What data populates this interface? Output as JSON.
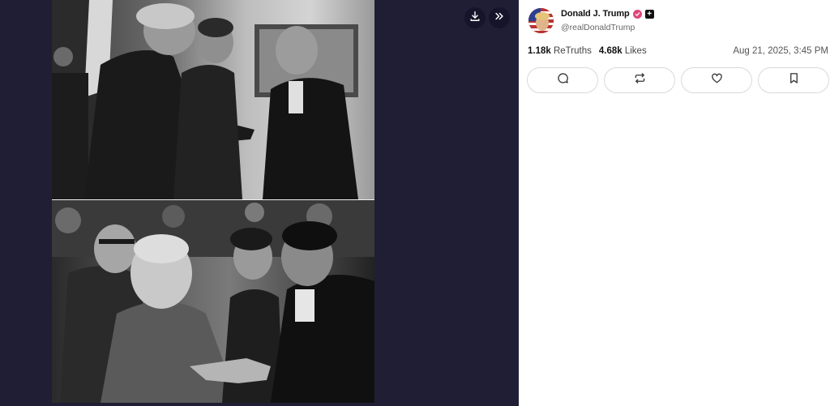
{
  "viewer": {
    "download_icon": "download-icon",
    "collapse_icon": "double-chevron-right-icon",
    "media": {
      "top_photo": "black-and-white photo of men in suits talking, one pointing",
      "bottom_photo": "black-and-white photo of a crowd and men in suits talking, one pointing"
    }
  },
  "post": {
    "author_name": "Donald J. Trump",
    "handle": "@realDonaldTrump",
    "retruths_count": "1.18k",
    "retruths_label": "ReTruths",
    "likes_count": "4.68k",
    "likes_label": "Likes",
    "timestamp": "Aug 21, 2025, 3:45 PM",
    "actions": [
      {
        "icon": "reply-icon"
      },
      {
        "icon": "retruth-icon"
      },
      {
        "icon": "like-icon"
      },
      {
        "icon": "bookmark-icon"
      }
    ]
  },
  "colors": {
    "viewer_bg": "#1f1e35",
    "panel_bg": "#ffffff",
    "verified": "#e0457a"
  }
}
